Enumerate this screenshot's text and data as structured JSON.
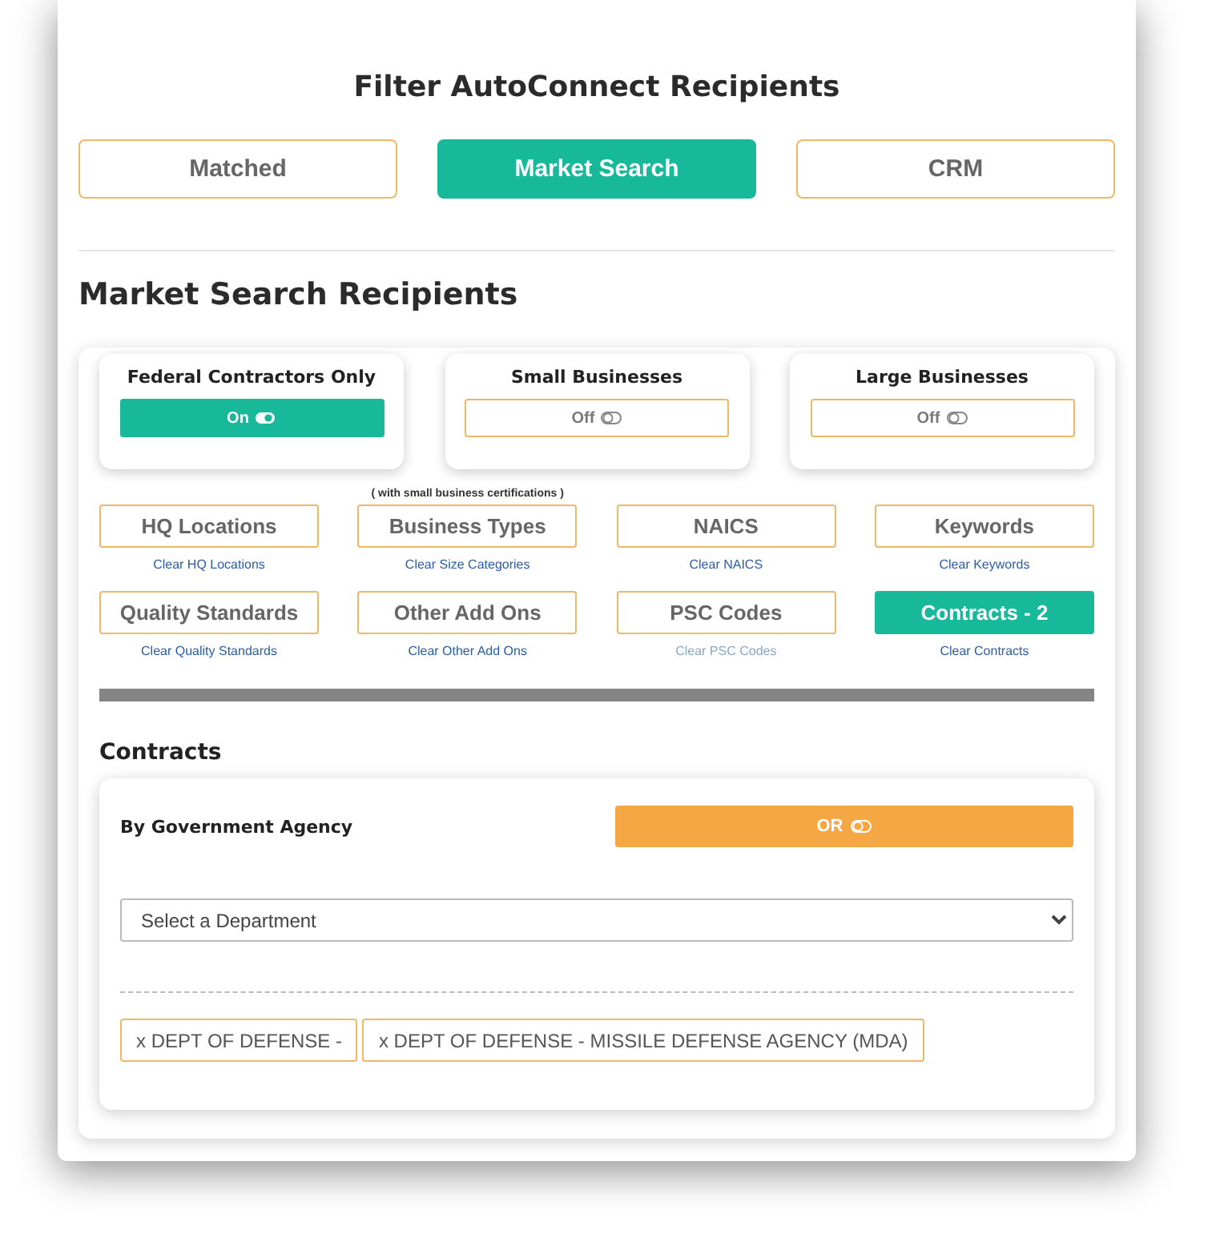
{
  "title": "Filter AutoConnect Recipients",
  "tabs": [
    {
      "label": "Matched",
      "selected": false
    },
    {
      "label": "Market Search",
      "selected": true
    },
    {
      "label": "CRM",
      "selected": false
    }
  ],
  "section_title": "Market Search Recipients",
  "toggles": [
    {
      "title": "Federal Contractors Only",
      "label": "On",
      "on": true
    },
    {
      "title": "Small Businesses",
      "label": "Off",
      "on": false
    },
    {
      "title": "Large Businesses",
      "label": "Off",
      "on": false
    }
  ],
  "filters": [
    {
      "label": "HQ Locations",
      "clear": "Clear HQ Locations",
      "selected": false,
      "disabled": false
    },
    {
      "label": "Business Types",
      "note": "( with small business certifications )",
      "clear": "Clear Size Categories",
      "selected": false,
      "disabled": false
    },
    {
      "label": "NAICS",
      "clear": "Clear NAICS",
      "selected": false,
      "disabled": false
    },
    {
      "label": "Keywords",
      "clear": "Clear Keywords",
      "selected": false,
      "disabled": false
    },
    {
      "label": "Quality Standards",
      "clear": "Clear Quality Standards",
      "selected": false,
      "disabled": false
    },
    {
      "label": "Other Add Ons",
      "clear": "Clear Other Add Ons",
      "selected": false,
      "disabled": false
    },
    {
      "label": "PSC Codes",
      "clear": "Clear PSC Codes",
      "selected": false,
      "disabled": true
    },
    {
      "label": "Contracts - 2",
      "clear": "Clear Contracts",
      "selected": true,
      "disabled": false
    }
  ],
  "contracts": {
    "title": "Contracts",
    "agency_label": "By Government Agency",
    "mode_button": "OR",
    "select": {
      "value": "Select a Department"
    },
    "tags": [
      "x DEPT OF DEFENSE -",
      "x DEPT OF DEFENSE - MISSILE DEFENSE AGENCY (MDA)"
    ]
  }
}
